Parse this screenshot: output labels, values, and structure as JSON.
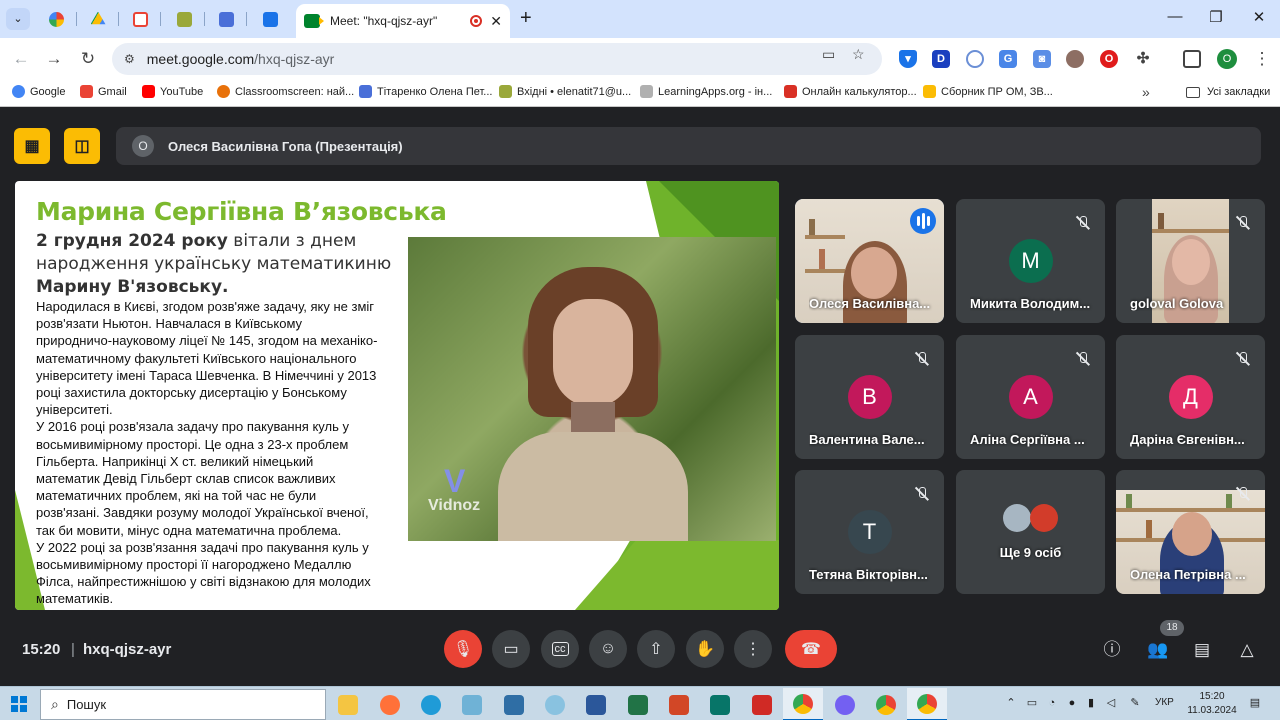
{
  "browser": {
    "active_tab_title": "Meet: \"hxq-qjsz-ayr\"",
    "url_host": "meet.google.com",
    "url_path": "/hxq-qjsz-ayr",
    "profile_initial": "O",
    "bookmarks": [
      {
        "label": "Google",
        "color": "#4285f4"
      },
      {
        "label": "Gmail",
        "color": "#ea4335"
      },
      {
        "label": "YouTube",
        "color": "#ff0000"
      },
      {
        "label": "Classroomscreen: най...",
        "color": "#e8710a"
      },
      {
        "label": "Тітаренко Олена Пет...",
        "color": "#4a6fd8"
      },
      {
        "label": "Вхідні • elenatit71@u...",
        "color": "#9aa83a"
      },
      {
        "label": "LearningApps.org - ін...",
        "color": "#b0b0b0"
      },
      {
        "label": "Онлайн калькулятор...",
        "color": "#d93025"
      },
      {
        "label": "Сборник ПР ОМ, ЗВ...",
        "color": "#fbbc04"
      }
    ],
    "all_bookmarks": "Усі закладки"
  },
  "meet": {
    "presenter_initial": "О",
    "presenter_label": "Олеся Василівна Гопа (Презентація)",
    "time": "15:20",
    "separator": "|",
    "meeting_code": "hxq-qjsz-ayr",
    "participant_count": "18"
  },
  "slide": {
    "title": "Марина Сергіївна В’язовська",
    "subtitle_bold1": "2 грудня 2024 року",
    "subtitle_rest": " вітали з днем народження українську математикиню ",
    "subtitle_bold2": "Марину В'язовську.",
    "body": "Народилася в Києві, згодом розв'яже задачу, яку не зміг\nрозв'язати Ньютон. Навчалася в Київському\nприродничо-науковому ліцеї № 145, згодом на механіко-\nматематичному факультеті Київського національного\nуніверситету імені Тараса Шевченка. В Німеччині у 2013\nроці захистила докторську дисертацію у Бонському\nуніверситеті.\nУ 2016 році розв'язала задачу про пакування куль у\nвосьмивимірному просторі. Це одна з 23-х проблем\nГільберта. Наприкінці Х ст. великий німецький\nматематик Девід Гільберт склав список важливих\nматематичних проблем, які на той час не були\nрозв'язані. Завдяки розуму молодої Української вченої,\nтак би мовити, мінус одна математична проблема.\nУ 2022 році за розв'язання задачі про пакування куль у\nвосьмивимірному просторі її нагороджено Медаллю\nФілса, найпрестижнішою у світі відзнакою для молодих\nматематиків.",
    "watermark_text": "Vidnoz"
  },
  "participants": [
    {
      "name": "Олеся Василівна...",
      "type": "video",
      "speaking": true
    },
    {
      "name": "Микита Володим...",
      "initial": "М",
      "color": "#0b6e4f"
    },
    {
      "name": "goloval Golova",
      "type": "video"
    },
    {
      "name": "Валентина Вале...",
      "initial": "В",
      "color": "#c2185b"
    },
    {
      "name": "Аліна Сергіївна ...",
      "initial": "А",
      "color": "#c2185b"
    },
    {
      "name": "Даріна Євгенівн...",
      "initial": "Д",
      "color": "#e52d68"
    },
    {
      "name": "Тетяна Вікторівн...",
      "initial": "Т",
      "color": "#37474f"
    },
    {
      "name": "Ще 9 осіб"
    },
    {
      "name": "Олена Петрівна ...",
      "type": "video"
    }
  ],
  "taskbar": {
    "search_placeholder": "Пошук",
    "language": "УКР",
    "time": "15:20",
    "date": "11.03.2024"
  }
}
